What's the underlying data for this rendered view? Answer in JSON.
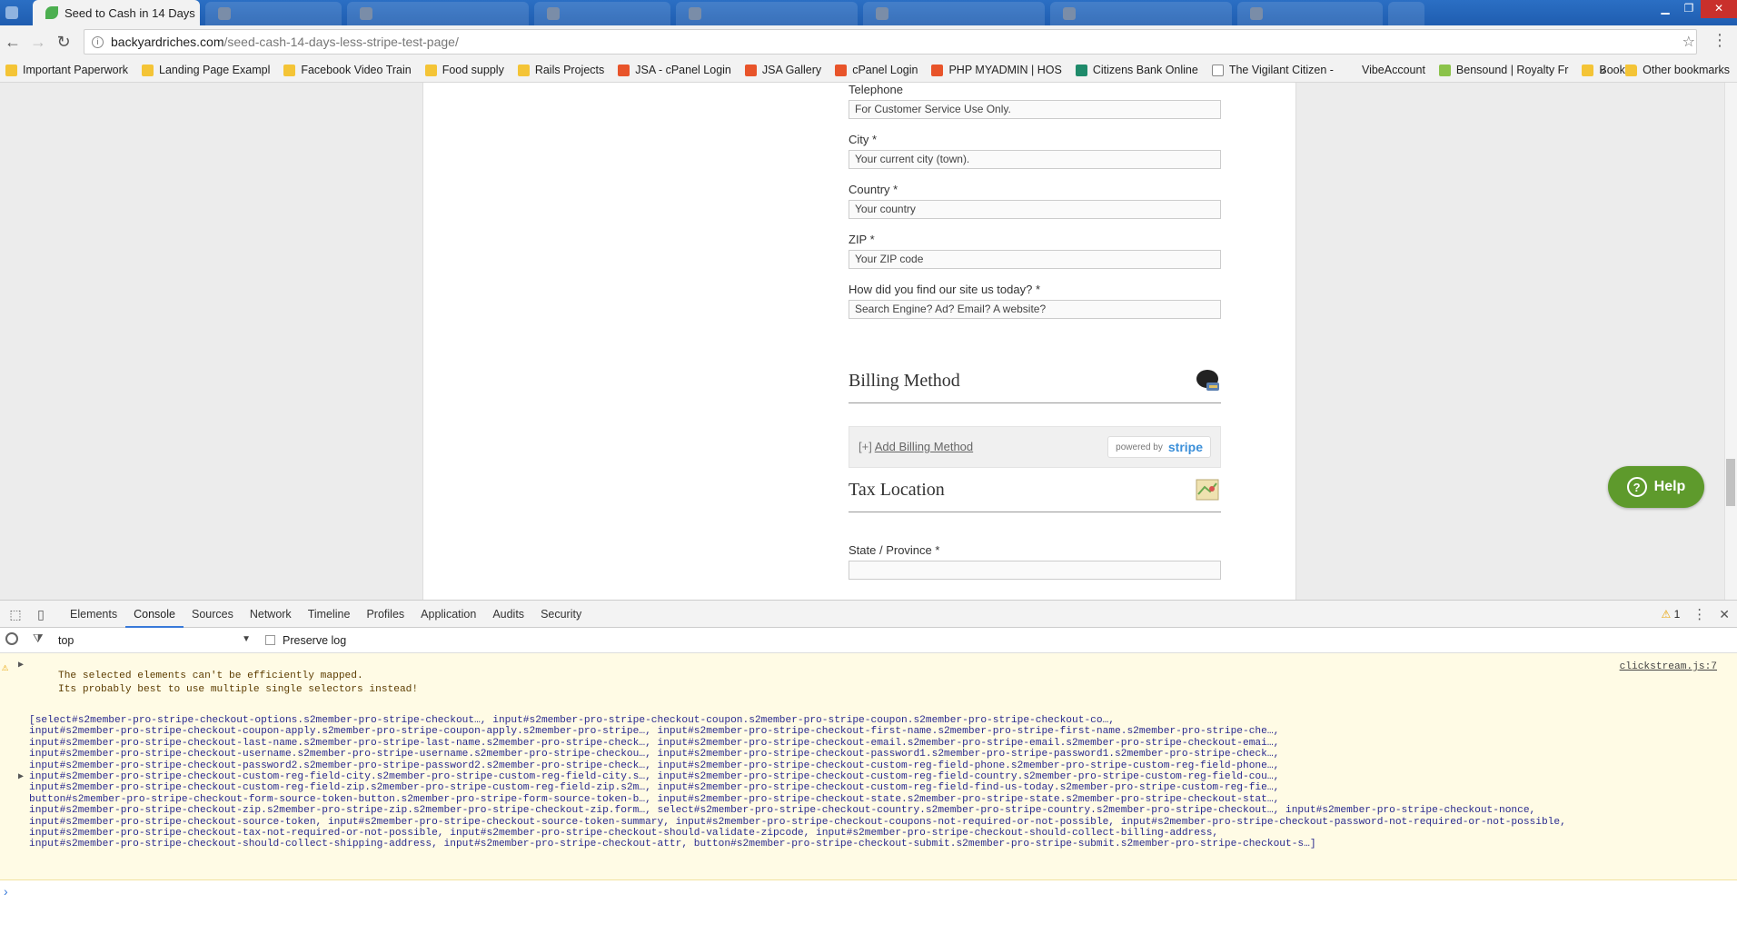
{
  "browser": {
    "active_tab_title": "Seed to Cash in 14 Days",
    "url_domain": "backyardriches.com",
    "url_path": "/seed-cash-14-days-less-stripe-test-page/",
    "bookmarks": [
      {
        "label": "Important Paperwork",
        "icon": "folder"
      },
      {
        "label": "Landing Page Exampl",
        "icon": "folder"
      },
      {
        "label": "Facebook Video Train",
        "icon": "folder"
      },
      {
        "label": "Food supply",
        "icon": "folder"
      },
      {
        "label": "Rails Projects",
        "icon": "folder"
      },
      {
        "label": "JSA - cPanel Login",
        "icon": "cpanel"
      },
      {
        "label": "JSA Gallery",
        "icon": "cpanel"
      },
      {
        "label": "cPanel Login",
        "icon": "cpanel"
      },
      {
        "label": "PHP MYADMIN | HOS",
        "icon": "cpanel"
      },
      {
        "label": "Citizens Bank Online",
        "icon": "bank"
      },
      {
        "label": "The Vigilant Citizen -",
        "icon": "page"
      },
      {
        "label": "VibeAccount",
        "icon": "none"
      },
      {
        "label": "Bensound | Royalty Fr",
        "icon": "bensound"
      },
      {
        "label": "Books",
        "icon": "folder"
      }
    ],
    "bookmarks_more": "»",
    "other_bookmarks": "Other bookmarks"
  },
  "form": {
    "telephone": {
      "label": "Telephone",
      "placeholder": "For Customer Service Use Only."
    },
    "city": {
      "label": "City *",
      "placeholder": "Your current city (town)."
    },
    "country": {
      "label": "Country *",
      "value": "Your country"
    },
    "zip": {
      "label": "ZIP *",
      "placeholder": "Your ZIP code"
    },
    "find_us": {
      "label": "How did you find our site us today? *",
      "placeholder": "Search Engine? Ad? Email? A website?"
    },
    "billing_title": "Billing Method",
    "add_billing_prefix": "[+]",
    "add_billing": "Add Billing Method",
    "powered_by": "powered by",
    "stripe": "stripe",
    "tax_title": "Tax Location",
    "state": {
      "label": "State / Province *",
      "placeholder": ""
    }
  },
  "help": {
    "label": "Help",
    "icon": "?"
  },
  "devtools": {
    "tabs": [
      "Elements",
      "Console",
      "Sources",
      "Network",
      "Timeline",
      "Profiles",
      "Application",
      "Audits",
      "Security"
    ],
    "selected_tab": "Console",
    "warning_count": "1",
    "context": "top",
    "preserve_log": "Preserve log",
    "warning_message": "The selected elements can't be efficiently mapped.\nIts probably best to use multiple single selectors instead!",
    "source": "clickstream.js:7",
    "array_lines": [
      "[select#s2member-pro-stripe-checkout-options.s2member-pro-stripe-checkout…, input#s2member-pro-stripe-checkout-coupon.s2member-pro-stripe-coupon.s2member-pro-stripe-checkout-co…,",
      "input#s2member-pro-stripe-checkout-coupon-apply.s2member-pro-stripe-coupon-apply.s2member-pro-stripe…, input#s2member-pro-stripe-checkout-first-name.s2member-pro-stripe-first-name.s2member-pro-stripe-che…,",
      "input#s2member-pro-stripe-checkout-last-name.s2member-pro-stripe-last-name.s2member-pro-stripe-check…, input#s2member-pro-stripe-checkout-email.s2member-pro-stripe-email.s2member-pro-stripe-checkout-emai…,",
      "input#s2member-pro-stripe-checkout-username.s2member-pro-stripe-username.s2member-pro-stripe-checkou…, input#s2member-pro-stripe-checkout-password1.s2member-pro-stripe-password1.s2member-pro-stripe-check…,",
      "input#s2member-pro-stripe-checkout-password2.s2member-pro-stripe-password2.s2member-pro-stripe-check…, input#s2member-pro-stripe-checkout-custom-reg-field-phone.s2member-pro-stripe-custom-reg-field-phone…,",
      "input#s2member-pro-stripe-checkout-custom-reg-field-city.s2member-pro-stripe-custom-reg-field-city.s…, input#s2member-pro-stripe-checkout-custom-reg-field-country.s2member-pro-stripe-custom-reg-field-cou…,",
      "input#s2member-pro-stripe-checkout-custom-reg-field-zip.s2member-pro-stripe-custom-reg-field-zip.s2m…, input#s2member-pro-stripe-checkout-custom-reg-field-find-us-today.s2member-pro-stripe-custom-reg-fie…,",
      "button#s2member-pro-stripe-checkout-form-source-token-button.s2member-pro-stripe-form-source-token-b…, input#s2member-pro-stripe-checkout-state.s2member-pro-stripe-state.s2member-pro-stripe-checkout-stat…,",
      "input#s2member-pro-stripe-checkout-zip.s2member-pro-stripe-zip.s2member-pro-stripe-checkout-zip.form…, select#s2member-pro-stripe-checkout-country.s2member-pro-stripe-country.s2member-pro-stripe-checkout…, input#s2member-pro-stripe-checkout-nonce,",
      "input#s2member-pro-stripe-checkout-source-token, input#s2member-pro-stripe-checkout-source-token-summary, input#s2member-pro-stripe-checkout-coupons-not-required-or-not-possible, input#s2member-pro-stripe-checkout-password-not-required-or-not-possible,",
      "input#s2member-pro-stripe-checkout-tax-not-required-or-not-possible, input#s2member-pro-stripe-checkout-should-validate-zipcode, input#s2member-pro-stripe-checkout-should-collect-billing-address,",
      "input#s2member-pro-stripe-checkout-should-collect-shipping-address, input#s2member-pro-stripe-checkout-attr, button#s2member-pro-stripe-checkout-submit.s2member-pro-stripe-submit.s2member-pro-stripe-checkout-s…]"
    ],
    "prompt": "›"
  }
}
